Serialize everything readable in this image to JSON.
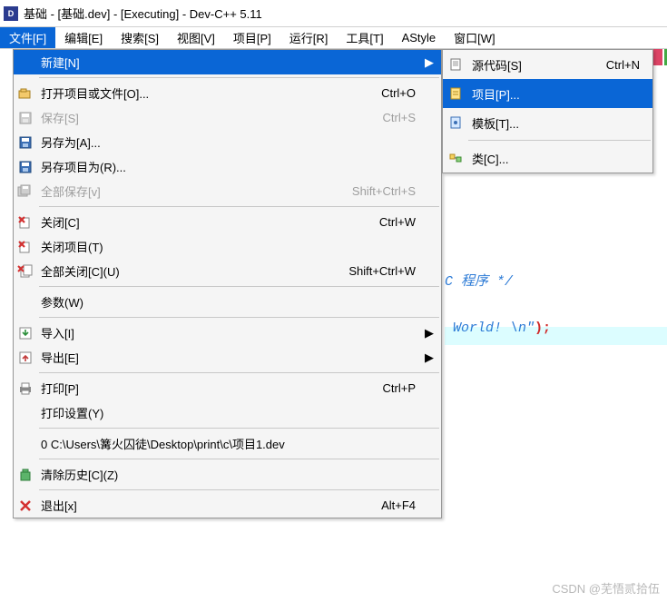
{
  "title": "基础 - [基础.dev] - [Executing] - Dev-C++ 5.11",
  "menubar": [
    "文件[F]",
    "编辑[E]",
    "搜索[S]",
    "视图[V]",
    "项目[P]",
    "运行[R]",
    "工具[T]",
    "AStyle",
    "窗口[W]"
  ],
  "active_menu_index": 0,
  "file_menu": [
    {
      "type": "item",
      "label": "新建[N]",
      "shortcut": "",
      "arrow": true,
      "highlight": true,
      "icon": ""
    },
    {
      "type": "sep"
    },
    {
      "type": "item",
      "label": "打开项目或文件[O]...",
      "shortcut": "Ctrl+O",
      "icon": "open"
    },
    {
      "type": "item",
      "label": "保存[S]",
      "shortcut": "Ctrl+S",
      "icon": "save",
      "disabled": true
    },
    {
      "type": "item",
      "label": "另存为[A]...",
      "shortcut": "",
      "icon": "save"
    },
    {
      "type": "item",
      "label": "另存项目为(R)...",
      "shortcut": "",
      "icon": "save"
    },
    {
      "type": "item",
      "label": "全部保存[v]",
      "shortcut": "Shift+Ctrl+S",
      "icon": "saveall",
      "disabled": true
    },
    {
      "type": "sep"
    },
    {
      "type": "item",
      "label": "关闭[C]",
      "shortcut": "Ctrl+W",
      "icon": "closered"
    },
    {
      "type": "item",
      "label": "关闭项目(T)",
      "shortcut": "",
      "icon": "closered"
    },
    {
      "type": "item",
      "label": "全部关闭[C](U)",
      "shortcut": "Shift+Ctrl+W",
      "icon": "closered2"
    },
    {
      "type": "sep"
    },
    {
      "type": "item",
      "label": "参数(W)",
      "shortcut": "",
      "icon": ""
    },
    {
      "type": "sep"
    },
    {
      "type": "item",
      "label": "导入[I]",
      "shortcut": "",
      "arrow": true,
      "icon": "import"
    },
    {
      "type": "item",
      "label": "导出[E]",
      "shortcut": "",
      "arrow": true,
      "icon": "export"
    },
    {
      "type": "sep"
    },
    {
      "type": "item",
      "label": "打印[P]",
      "shortcut": "Ctrl+P",
      "icon": "print"
    },
    {
      "type": "item",
      "label": "打印设置(Y)",
      "shortcut": "",
      "icon": ""
    },
    {
      "type": "sep"
    },
    {
      "type": "item",
      "label": "0 C:\\Users\\篝火囚徒\\Desktop\\print\\c\\项目1.dev",
      "shortcut": "",
      "icon": ""
    },
    {
      "type": "sep"
    },
    {
      "type": "item",
      "label": "清除历史[C](Z)",
      "shortcut": "",
      "icon": "clear"
    },
    {
      "type": "sep"
    },
    {
      "type": "item",
      "label": "退出[x]",
      "shortcut": "Alt+F4",
      "icon": "exit"
    }
  ],
  "new_submenu": [
    {
      "type": "item",
      "label": "源代码[S]",
      "shortcut": "Ctrl+N",
      "icon": "source"
    },
    {
      "type": "item",
      "label": "项目[P]...",
      "shortcut": "",
      "icon": "project",
      "highlight": true
    },
    {
      "type": "item",
      "label": "模板[T]...",
      "shortcut": "",
      "icon": "template"
    },
    {
      "type": "sep"
    },
    {
      "type": "item",
      "label": "类[C]...",
      "shortcut": "",
      "icon": "class"
    }
  ],
  "code": {
    "line1": "C 程序 */",
    "line2_hello": " World! \\n\"",
    "line2_paren": ")",
    "line2_semi": ";"
  },
  "watermark": "CSDN @芜悟贰拾伍"
}
